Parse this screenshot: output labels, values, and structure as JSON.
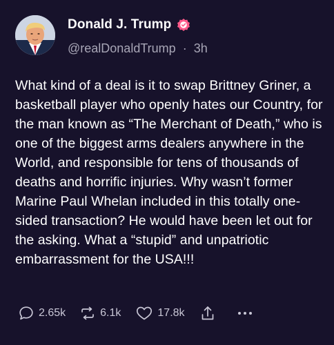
{
  "post": {
    "author": {
      "display_name": "Donald J. Trump",
      "handle": "@realDonaldTrump",
      "separator": "·",
      "time": "3h",
      "verified": true
    },
    "text": "What kind of a deal is it to swap Brittney Griner, a basketball player who openly hates our Country, for the man known as “The Merchant of Death,” who is one of the biggest arms dealers anywhere in the World, and responsible for tens of thousands of deaths and horrific injuries. Why wasn’t former Marine Paul Whelan included in this totally one-sided transaction? He would have been let out for the asking. What a “stupid” and unpatriotic embarrassment for the USA!!!",
    "actions": {
      "replies": "2.65k",
      "reposts": "6.1k",
      "likes": "17.8k"
    }
  },
  "icons": {
    "reply": "speech-bubble-icon",
    "repost": "repost-arrows-icon",
    "like": "heart-icon",
    "share": "share-upload-icon",
    "more": "ellipsis-icon",
    "verified": "verified-badge-icon"
  },
  "colors": {
    "background": "#17122b",
    "text": "#ffffff",
    "secondary_text": "#a8a6b6",
    "verified_badge": "#ff5a8a"
  }
}
